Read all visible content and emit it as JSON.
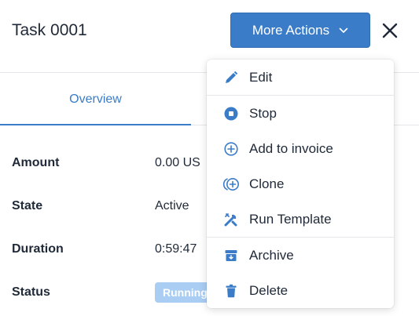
{
  "header": {
    "title": "Task 0001",
    "more_actions_label": "More Actions"
  },
  "tabs": [
    {
      "label": "Overview",
      "active": true
    }
  ],
  "details": [
    {
      "label": "Amount",
      "value": "0.00 US"
    },
    {
      "label": "State",
      "value": "Active"
    },
    {
      "label": "Duration",
      "value": "0:59:47"
    },
    {
      "label": "Status",
      "value": "Running"
    }
  ],
  "menu": {
    "items": [
      {
        "label": "Edit",
        "icon": "pencil-icon"
      },
      {
        "label": "Stop",
        "icon": "stop-circle-icon"
      },
      {
        "label": "Add to invoice",
        "icon": "plus-circle-icon"
      },
      {
        "label": "Clone",
        "icon": "clone-icon"
      },
      {
        "label": "Run Template",
        "icon": "tools-icon"
      },
      {
        "label": "Archive",
        "icon": "archive-icon"
      },
      {
        "label": "Delete",
        "icon": "trash-icon"
      }
    ]
  },
  "colors": {
    "accent": "#3a7cc7",
    "badge_bg": "#a9cdf3"
  }
}
